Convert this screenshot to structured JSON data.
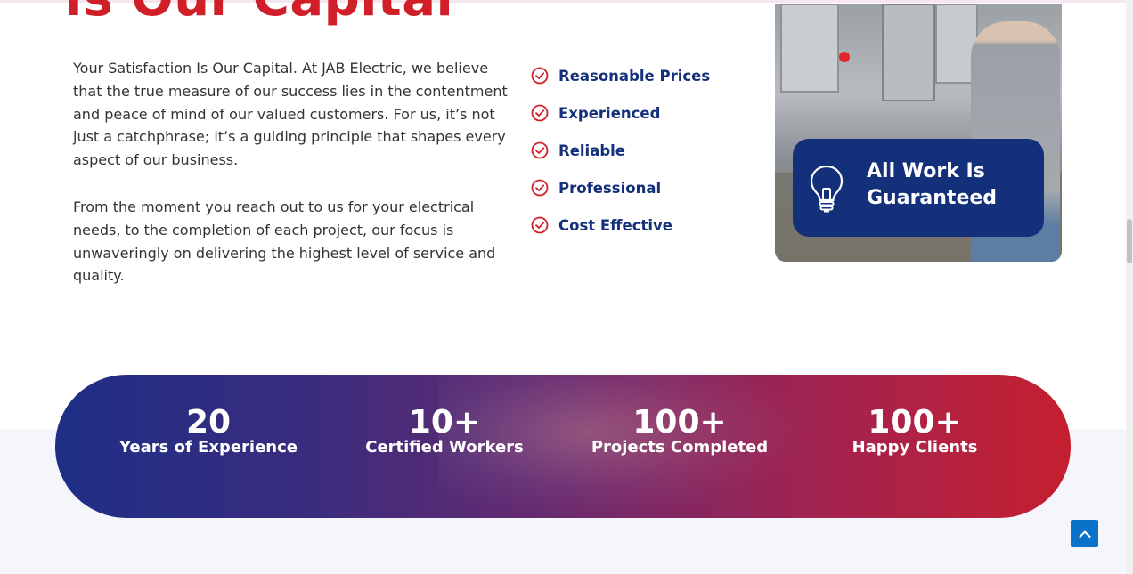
{
  "heading": "Is Our Capital",
  "paragraphs": [
    "Your Satisfaction Is Our Capital. At JAB Electric, we believe that the true measure of our success lies in the contentment and peace of mind of our valued customers. For us, it’s not just a catchphrase; it’s a guiding principle that shapes every aspect of our business.",
    "From the moment you reach out to us for your electrical needs, to the completion of each project, our focus is unwaveringly on delivering the highest level of service and quality."
  ],
  "features": [
    {
      "label": "Reasonable Prices",
      "icon": "check-circle-icon"
    },
    {
      "label": "Experienced",
      "icon": "check-circle-icon"
    },
    {
      "label": "Reliable",
      "icon": "check-circle-icon"
    },
    {
      "label": "Professional",
      "icon": "check-circle-icon"
    },
    {
      "label": "Cost Effective",
      "icon": "check-circle-icon"
    }
  ],
  "badge": {
    "text": "All Work Is Guaranteed",
    "icon": "lightbulb-icon"
  },
  "stats": [
    {
      "number": "20",
      "caption": "Years of Experience"
    },
    {
      "number": "10+",
      "caption": "Certified Workers"
    },
    {
      "number": "100+",
      "caption": "Projects Completed"
    },
    {
      "number": "100+",
      "caption": "Happy Clients"
    }
  ],
  "scroll_top": {
    "icon": "chevron-up-icon"
  },
  "colors": {
    "accent_red": "#d11f2a",
    "brand_blue": "#14307a",
    "scroll_button": "#0a72c9"
  }
}
